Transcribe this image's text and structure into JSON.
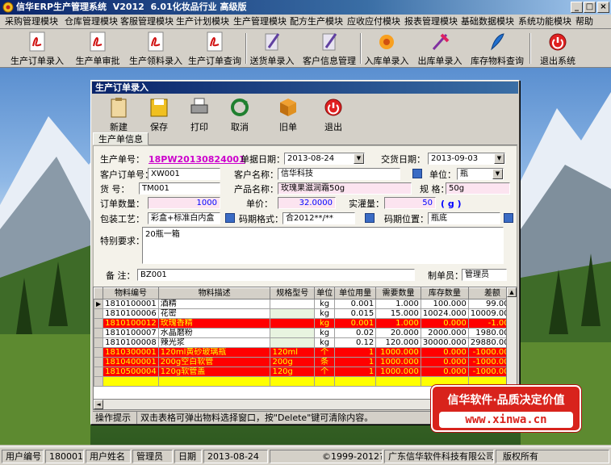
{
  "window": {
    "title": "信华ERP生产管理系统  V2012  6.01化妆品行业 高级版",
    "controls": [
      "minimize",
      "maximize",
      "close"
    ]
  },
  "menu": [
    "采购管理模块",
    "仓库管理模块",
    "客服管理模块",
    "生产计划模块",
    "生产管理模块",
    "配方生产模块",
    "应收应付模块",
    "报表管理模块",
    "基础数据模块",
    "系统功能模块",
    "帮助"
  ],
  "toolbar": [
    {
      "label": "生产订单录入",
      "icon": "pdf-doc-icon"
    },
    {
      "label": "生产单审批",
      "icon": "pdf-doc-icon"
    },
    {
      "label": "生产领料录入",
      "icon": "pdf-doc-icon"
    },
    {
      "label": "生产订单查询",
      "icon": "pdf-doc-icon"
    },
    {
      "label": "送货单录入",
      "icon": "quill-pen-icon"
    },
    {
      "label": "客户信息管理",
      "icon": "quill-pen-icon"
    },
    {
      "label": "入库单录入",
      "icon": "flower-icon"
    },
    {
      "label": "出库单录入",
      "icon": "wand-icon"
    },
    {
      "label": "库存物料查询",
      "icon": "feather-icon"
    },
    {
      "label": "退出系统",
      "icon": "exit-icon"
    }
  ],
  "child_window": {
    "title": "生产订单录入",
    "toolbar": [
      {
        "label": "新建",
        "icon": "clipboard-icon"
      },
      {
        "label": "保存",
        "icon": "save-disk-icon"
      },
      {
        "label": "打印",
        "icon": "printer-icon"
      },
      {
        "label": "取消",
        "icon": "refresh-cancel-icon"
      },
      {
        "label": "旧单",
        "icon": "boxes-icon"
      },
      {
        "label": "退出",
        "icon": "exit-icon"
      }
    ],
    "tab": "生产单信息"
  },
  "form": {
    "order_no_label": "生产单号：",
    "order_no": "18PW20130824001",
    "doc_date_label": "单据日期：",
    "doc_date": "2013-08-24",
    "delivery_date_label": "交货日期：",
    "delivery_date": "2013-09-03",
    "cust_order_label": "客户订单号：",
    "cust_order": "XW001",
    "cust_name_label": "客户名称：",
    "cust_name": "信华科技",
    "unit_label": "单位：",
    "unit": "瓶",
    "item_no_label": "货  号：",
    "item_no": "TM001",
    "product_name_label": "产品名称：",
    "product_name": "玫瑰果滋润霜50g",
    "spec_label": "规  格：",
    "spec": "50g",
    "order_qty_label": "订单数量：",
    "order_qty": "1000",
    "unit_price_label": "单价：",
    "unit_price": "32.0000",
    "actual_label": "实灌量：",
    "actual": "50",
    "actual_unit": "( g )",
    "packing_label": "包装工艺：",
    "packing": "彩盒+标准白内盒",
    "code_format_label": "码期格式：",
    "code_format": "合2012**/**",
    "code_pos_label": "码期位置：",
    "code_pos": "瓶底",
    "special_label": "特别要求：",
    "special": "20瓶一箱",
    "remark_label": "备  注：",
    "remark": "BZ001",
    "creator_label": "制单员：",
    "creator": "管理员"
  },
  "grid": {
    "columns": [
      "物料编号",
      "物料描述",
      "规格型号",
      "单位",
      "单位用量",
      "需要数量",
      "库存数量",
      "差额"
    ],
    "rows": [
      {
        "code": "1810100001",
        "desc": "酒精",
        "spec": "",
        "unit": "kg",
        "usage": "0.001",
        "need": "1.000",
        "stock": "100.000",
        "diff": "99.000",
        "style": "sel"
      },
      {
        "code": "1810100006",
        "desc": "花密",
        "spec": "",
        "unit": "kg",
        "usage": "0.015",
        "need": "15.000",
        "stock": "10024.000",
        "diff": "10009.000",
        "style": ""
      },
      {
        "code": "1810100012",
        "desc": "玫瑰香精",
        "spec": "",
        "unit": "kg",
        "usage": "0.001",
        "need": "1.000",
        "stock": "0.000",
        "diff": "-1.000",
        "style": "hl"
      },
      {
        "code": "1810100007",
        "desc": "水晶磨粉",
        "spec": "",
        "unit": "kg",
        "usage": "0.02",
        "need": "20.000",
        "stock": "2000.000",
        "diff": "1980.000",
        "style": ""
      },
      {
        "code": "1810100008",
        "desc": "辣光浆",
        "spec": "",
        "unit": "kg",
        "usage": "0.12",
        "need": "120.000",
        "stock": "30000.000",
        "diff": "29880.000",
        "style": ""
      },
      {
        "code": "1810300001",
        "desc": "120ml黄砂玻璃瓶",
        "spec": "120ml",
        "unit": "个",
        "usage": "1",
        "need": "1000.000",
        "stock": "0.000",
        "diff": "-1000.000",
        "style": "hl"
      },
      {
        "code": "1810400001",
        "desc": "200g空白软管",
        "spec": "200g",
        "unit": "条",
        "usage": "1",
        "need": "1000.000",
        "stock": "0.000",
        "diff": "-1000.000",
        "style": "hl"
      },
      {
        "code": "1810500004",
        "desc": "120g软管盖",
        "spec": "120g",
        "unit": "个",
        "usage": "1",
        "need": "1000.000",
        "stock": "0.000",
        "diff": "-1000.000",
        "style": "hl"
      },
      {
        "code": "",
        "desc": "",
        "spec": "",
        "unit": "",
        "usage": "",
        "need": "",
        "stock": "",
        "diff": "",
        "style": "yl"
      }
    ]
  },
  "hint": {
    "label": "操作提示",
    "text": "双击表格可弹出物料选择窗口，按\"Delete\"键可清除内容。"
  },
  "banner": {
    "slogan": "信华软件·品质决定价值",
    "url": "www.xinwa.cn"
  },
  "status": {
    "user_no_label": "用户编号",
    "user_no": "180001",
    "user_name_label": "用户姓名",
    "user_name": "管理员",
    "date_label": "日期",
    "date": "2013-08-24",
    "copyright": "©1999-2012?",
    "company": "广东信华软件科技有限公司",
    "rights": "版权所有"
  },
  "colors": {
    "title_bar": "#0a246a",
    "highlight_row": "#ff0000",
    "highlight_text": "#ffff00",
    "order_no_text": "#cc00cc",
    "banner": "#d8231c"
  }
}
